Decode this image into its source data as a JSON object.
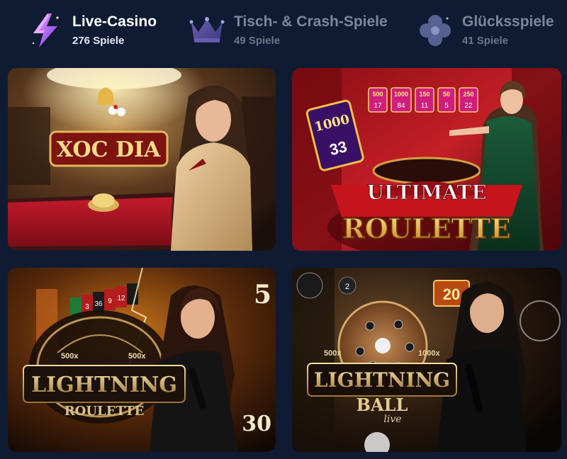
{
  "categories": [
    {
      "name": "Live-Casino",
      "count": "276 Spiele",
      "icon": "lightning-icon",
      "active": true
    },
    {
      "name": "Tisch- & Crash-Spiele",
      "count": "49 Spiele",
      "icon": "crown-icon",
      "active": false
    },
    {
      "name": "Glücksspiele",
      "count": "41 Spiele",
      "icon": "clover-icon",
      "active": false
    }
  ],
  "games": [
    {
      "title": "XOC DIA",
      "art": "xoc-dia"
    },
    {
      "title_top": "ULTIMATE",
      "title_bottom": "ROULETTE",
      "card_value": "1000",
      "card_number": "33",
      "multipliers": [
        {
          "x": "500",
          "n": "17"
        },
        {
          "x": "1000",
          "n": "84"
        },
        {
          "x": "150",
          "n": "11"
        },
        {
          "x": "50",
          "n": "5"
        },
        {
          "x": "250",
          "n": "22"
        }
      ]
    },
    {
      "title_top": "LIGHTNING",
      "title_bottom": "ROULETTE",
      "mult_left": "500x",
      "mult_right": "500x",
      "board_numbers": [
        "3",
        "36",
        "9",
        "12"
      ],
      "side_top": "5",
      "side_bottom": "30"
    },
    {
      "title_top": "LIGHTNING",
      "title_bottom": "BALL",
      "title_script": "live",
      "mult_left": "500x",
      "mult_right": "1000x",
      "badge_number": "20",
      "ball_number": "2"
    }
  ],
  "colors": {
    "background": "#0f1b33",
    "active_text": "#ffffff",
    "inactive_text": "#7c879c"
  }
}
